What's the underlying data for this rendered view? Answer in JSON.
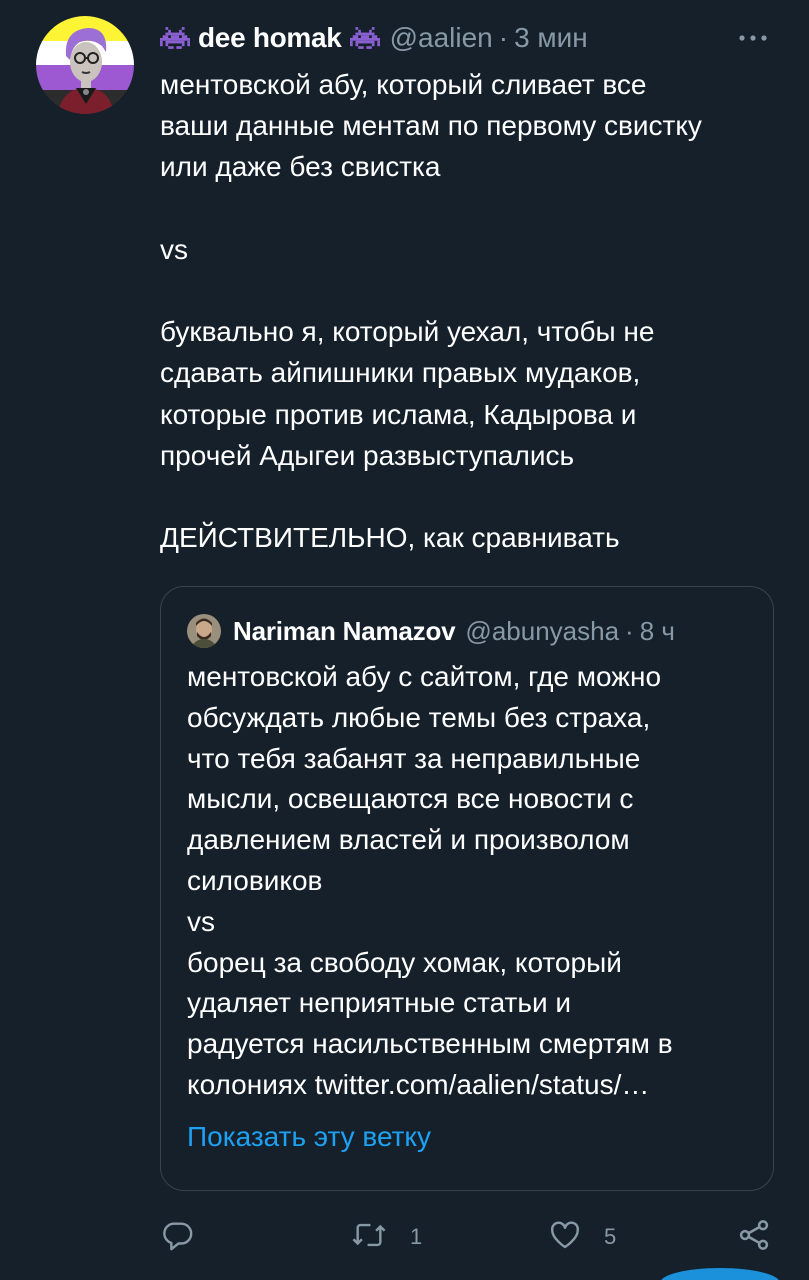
{
  "author": {
    "display_name": "dee homak",
    "handle": "@aalien",
    "separator": "·",
    "time": "3 мин",
    "name_emoji": "alien-monster-icon"
  },
  "tweet_lines": [
    "ментовской абу, который сливает все",
    "ваши данные ментам по первому свистку",
    "или даже без свистка",
    "",
    "vs",
    "",
    "буквально я, который уехал, чтобы не",
    "сдавать айпишники правых мудаков,",
    "которые против ислама, Кадырова и",
    "прочей Адыгеи развыступались",
    "",
    "ДЕЙСТВИТЕЛЬНО, как сравнивать"
  ],
  "quote": {
    "display_name": "Nariman Namazov",
    "handle": "@abunyasha",
    "separator": "·",
    "time": "8 ч",
    "lines": [
      "ментовской абу с сайтом, где можно",
      "обсуждать любые темы без страха,",
      "что тебя забанят за неправильные",
      "мысли, освещаются все новости с",
      "давлением властей и произволом",
      "силовиков",
      "vs",
      "борец за свободу хомак, который",
      "удаляет неприятные статьи и",
      "радуется насильственным смертям в",
      "колониях twitter.com/aalien/status/…"
    ],
    "show_thread": "Показать эту ветку"
  },
  "actions": {
    "reply_count": "",
    "retweet_count": "1",
    "like_count": "5"
  },
  "colors": {
    "background": "#15202b",
    "text": "#ffffff",
    "secondary": "#8899a6",
    "link": "#1da1f2",
    "border": "#38444d",
    "alien": "#8a5fd1",
    "flag_yellow": "#fcf434",
    "flag_white": "#ffffff",
    "flag_purple": "#9c59d1",
    "flag_black": "#2c2c2c"
  }
}
